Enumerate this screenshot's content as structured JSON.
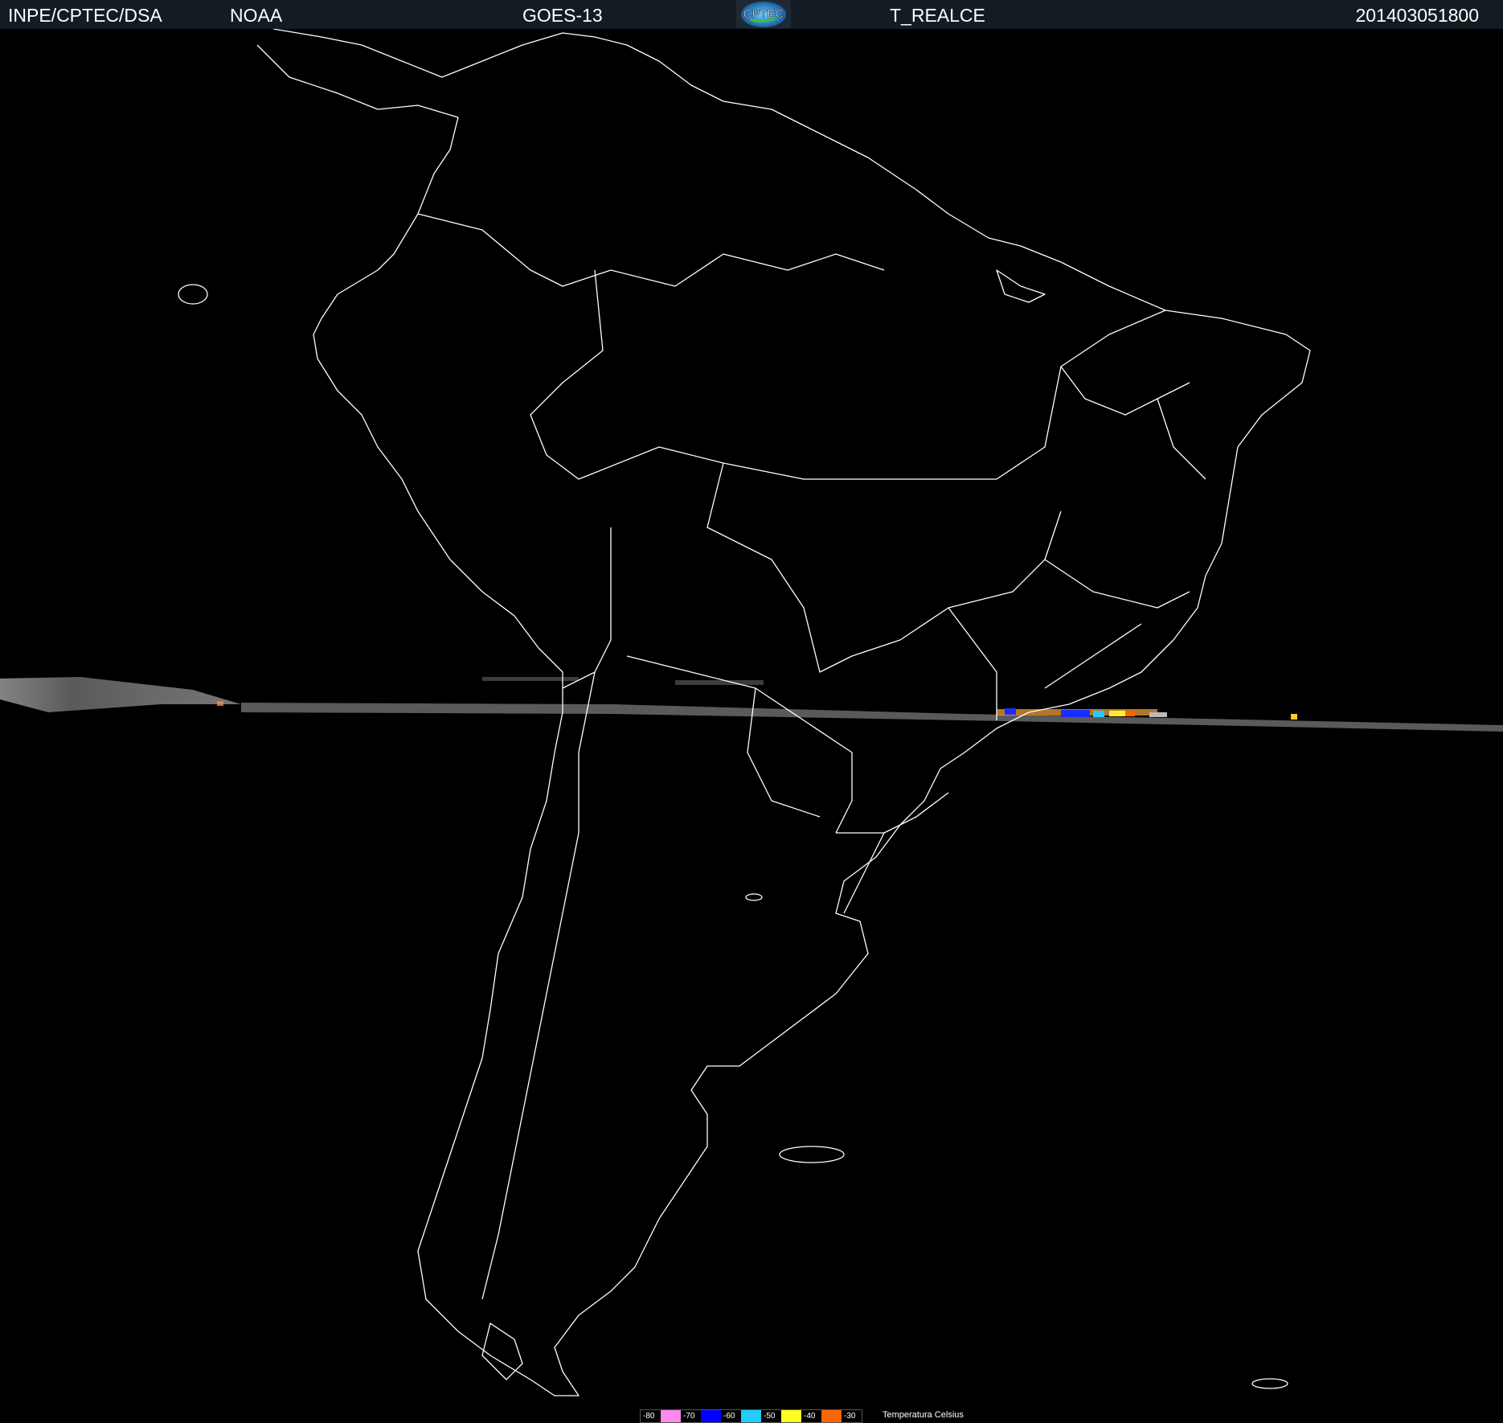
{
  "header": {
    "organization": "INPE/CPTEC/DSA",
    "agency": "NOAA",
    "satellite": "GOES-13",
    "logo_text": "CPTEC",
    "product": "T_REALCE",
    "timestamp": "201403051800"
  },
  "legend": {
    "title": "Temperatura   Celsius",
    "entries": [
      {
        "label": "-80",
        "color": "#000000"
      },
      {
        "label": "",
        "color": "#ff88ee"
      },
      {
        "label": "-70",
        "color": "#000000"
      },
      {
        "label": "",
        "color": "#0000ff"
      },
      {
        "label": "-60",
        "color": "#000000"
      },
      {
        "label": "",
        "color": "#22ccff"
      },
      {
        "label": "-50",
        "color": "#000000"
      },
      {
        "label": "",
        "color": "#ffff22"
      },
      {
        "label": "-40",
        "color": "#000000"
      },
      {
        "label": "",
        "color": "#ff6600"
      },
      {
        "label": "-30",
        "color": "#000000"
      }
    ]
  },
  "colors": {
    "background": "#000000",
    "coastline": "#ffffff",
    "header_bg": "#131c22"
  },
  "map": {
    "region": "south-america",
    "imagery": "satellite-ir-enhanced-strip"
  }
}
